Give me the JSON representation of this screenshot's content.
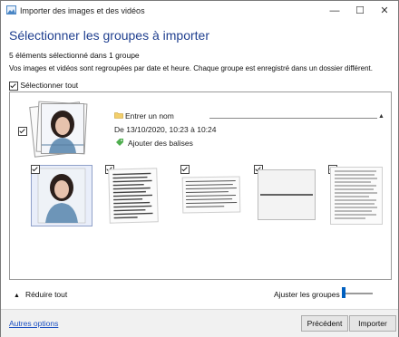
{
  "window": {
    "title": "Importer des images et des vidéos",
    "controls": {
      "minimize": "—",
      "maximize": "☐",
      "close": "✕"
    }
  },
  "header": {
    "heading": "Sélectionner les groupes à importer",
    "selection_summary": "5 éléments sélectionné dans 1 groupe",
    "description": "Vos images et vidéos sont regroupées par date et heure. Chaque groupe est enregistré dans un dossier différent."
  },
  "select_all": {
    "label": "Sélectionner tout",
    "checked": true
  },
  "group": {
    "checked": true,
    "name_placeholder": "Entrer un nom",
    "date_range": "De 13/10/2020, 10:23 à 10:24",
    "add_tags": "Ajouter des balises",
    "icons": {
      "folder": "folder-icon",
      "tag": "tag-icon",
      "collapse": "caret-up-icon"
    },
    "items": [
      {
        "type": "photo",
        "checked": true,
        "selected": true
      },
      {
        "type": "document",
        "checked": true
      },
      {
        "type": "document",
        "checked": true
      },
      {
        "type": "document",
        "checked": true
      },
      {
        "type": "document",
        "checked": true
      }
    ]
  },
  "controls": {
    "collapse_all": "Réduire tout",
    "adjust_groups": "Ajuster les groupes :"
  },
  "footer": {
    "more_options": "Autres options",
    "previous": "Précédent",
    "import": "Importer"
  },
  "colors": {
    "heading": "#1f3f8f",
    "link": "#1a4fc1",
    "slider": "#0060c0"
  }
}
